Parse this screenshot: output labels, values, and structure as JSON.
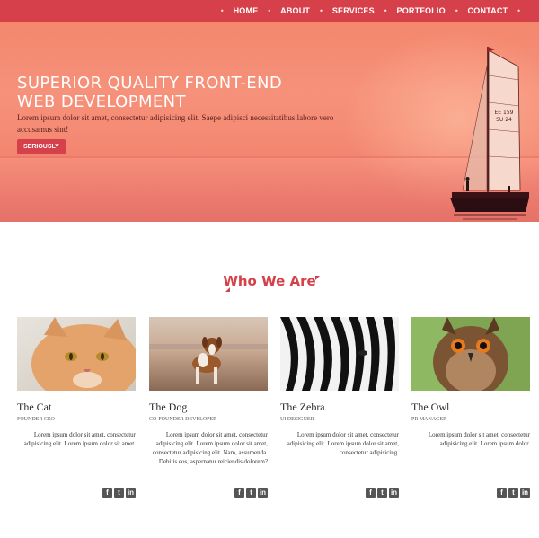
{
  "nav": {
    "items": [
      {
        "label": "HOME"
      },
      {
        "label": "ABOUT"
      },
      {
        "label": "SERVICES"
      },
      {
        "label": "PORTFOLIO"
      },
      {
        "label": "CONTACT"
      }
    ]
  },
  "hero": {
    "title": "SUPERIOR QUALITY FRONT-END WEB DEVELOPMENT",
    "text": "Lorem ipsum dolor sit amet, consectetur adipisicing elit. Saepe adipisci necessitatibus labore vero accusamus sint!",
    "button": "SERIOUSLY",
    "sail_text": [
      "EE 159",
      "SU 24"
    ]
  },
  "section": {
    "title": "Who We Are"
  },
  "team": [
    {
      "name": "The Cat",
      "role": "FOUNDER CEO",
      "bio": "Lorem ipsum dolor sit amet, consectetur adipisicing elit. Lorem ipsum dolor sit amet.",
      "icon": "cat-photo"
    },
    {
      "name": "The Dog",
      "role": "CO-FOUNDER DEVELOPER",
      "bio": "Lorem ipsum dolor sit amet, consectetur adipisicing elit. Lorem ipsum dolor sit amet, consectetur adipisicing elit. Nam, assumenda. Debitis eos, aspernatur reiciendis dolorem?",
      "icon": "dog-photo"
    },
    {
      "name": "The Zebra",
      "role": "UI DESIGNER",
      "bio": "Lorem ipsum dolor sit amet, consectetur adipisicing elit. Lorem ipsum dolor sit amet, consectetur adipisicing.",
      "icon": "zebra-photo"
    },
    {
      "name": "The Owl",
      "role": "PR MANAGER",
      "bio": "Lorem ipsum dolor sit amet, consectetur adipisicing elit. Lorem ipsum dolor.",
      "icon": "owl-photo"
    }
  ],
  "social": {
    "facebook": "f",
    "twitter": "t",
    "linkedin": "in"
  },
  "colors": {
    "accent": "#d6404a",
    "hero": "#f58b74"
  }
}
